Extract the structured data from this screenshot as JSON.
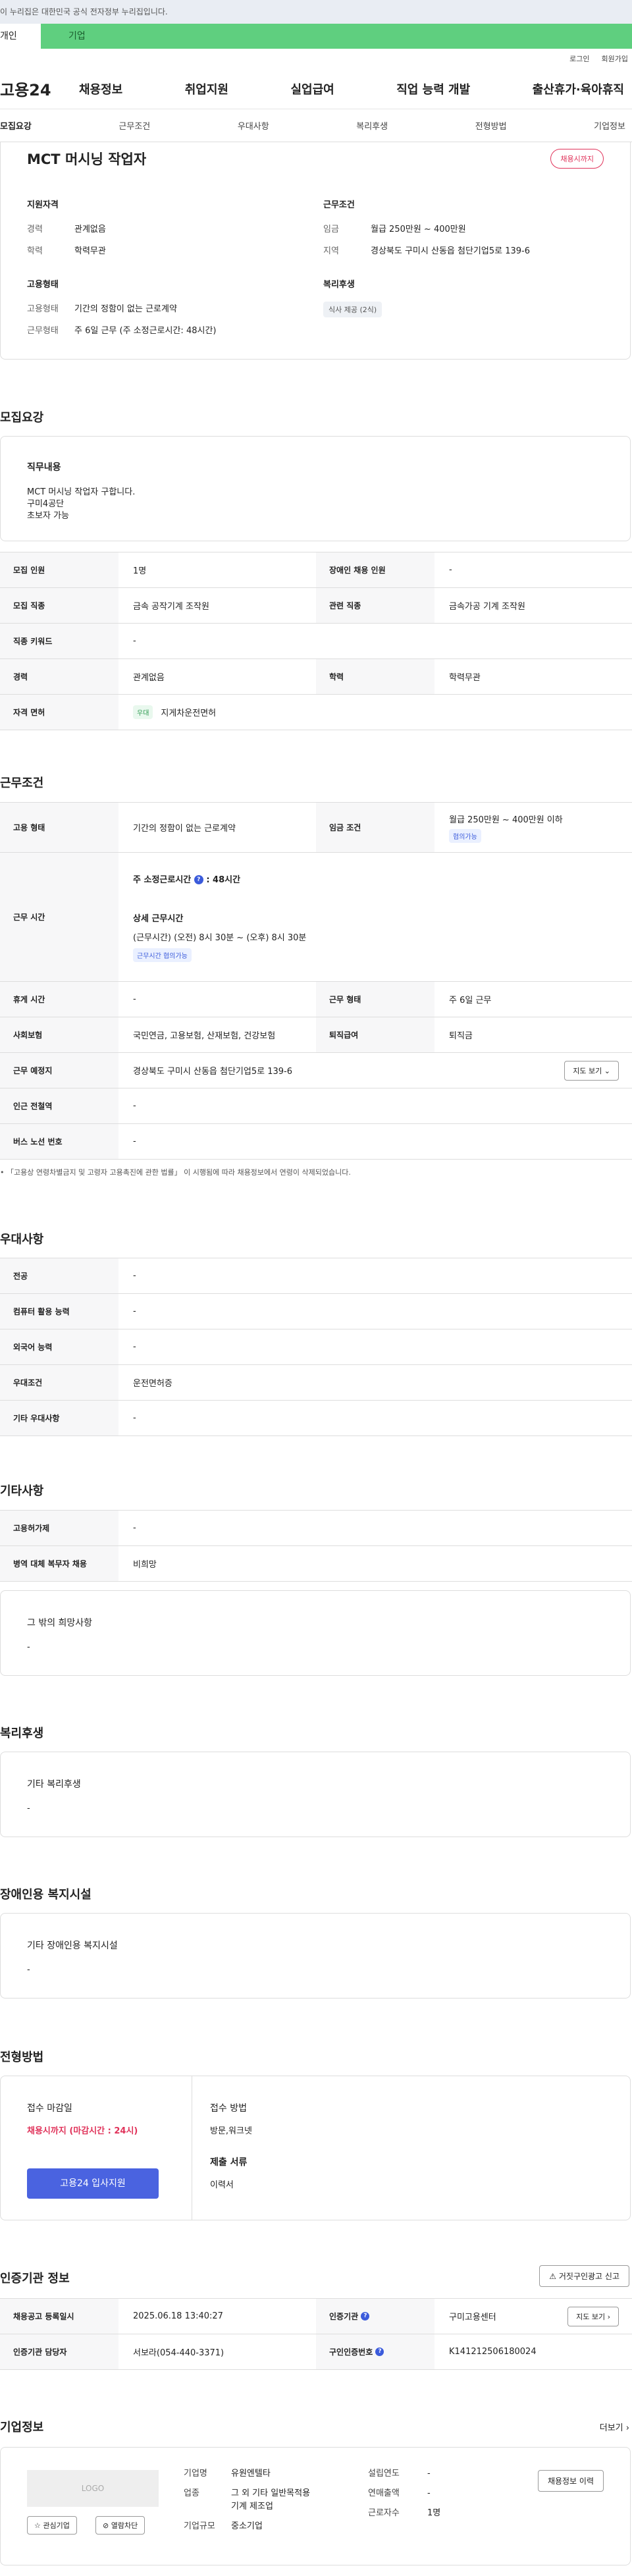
{
  "gov_banner": "이 누리집은 대한민국 공식 전자정부 누리집입니다.",
  "user_tabs": {
    "individual": "개인",
    "business": "기업"
  },
  "top_links": {
    "login": "로그인",
    "join": "회원가입"
  },
  "gnb": {
    "logo": "고용24",
    "menu": [
      "채용정보",
      "취업지원",
      "실업급여",
      "직업 능력 개발",
      "출산휴가·육아휴직"
    ]
  },
  "subtabs": [
    "모집요강",
    "근무조건",
    "우대사항",
    "복리후생",
    "전형방법",
    "기업정보"
  ],
  "job": {
    "title": "MCT 머시닝 작업자",
    "status_badge": "채용시까지",
    "qualification": {
      "heading": "지원자격",
      "career_label": "경력",
      "career": "관계없음",
      "edu_label": "학력",
      "edu": "학력무관"
    },
    "condition": {
      "heading": "근무조건",
      "wage_label": "임금",
      "wage": "월급 250만원 ~ 400만원",
      "region_label": "지역",
      "region": "경상북도 구미시 산동읍 첨단기업5로 139-6"
    },
    "employment": {
      "heading": "고용형태",
      "type_label": "고용형태",
      "type": "기간의 정함이 없는 근로계약",
      "hours_label": "근무형태",
      "hours": "주 6일 근무 (주 소정근로시간: 48시간)"
    },
    "welfare": {
      "heading": "복리후생",
      "chip": "식사 제공 (2식)"
    }
  },
  "recruit": {
    "section_title": "모집요강",
    "duty_heading": "직무내용",
    "duty_lines": [
      "MCT 머시닝 작업자 구합니다.",
      "구미4공단",
      "초보자 가능"
    ],
    "rows": [
      {
        "k1": "모집 인원",
        "v1": "1명",
        "k2": "장애인 채용 인원",
        "v2": "-"
      },
      {
        "k1": "모집 직종",
        "v1": "금속 공작기계 조작원",
        "k2": "관련 직종",
        "v2": "금속가공 기계 조작원"
      },
      {
        "k1": "직종 키워드",
        "v1": "-"
      },
      {
        "k1": "경력",
        "v1": "관계없음",
        "k2": "학력",
        "v2": "학력무관"
      },
      {
        "k1": "자격 면허",
        "tag": "우대",
        "v1": "지게차운전면허"
      }
    ]
  },
  "work": {
    "section_title": "근무조건",
    "emp_type_label": "고용 형태",
    "emp_type": "기간의 정함이 없는 근로계약",
    "wage_label": "임금 조건",
    "wage": "월급 250만원 ~ 400만원 이하",
    "wage_tag": "협의가능",
    "hours_label": "근무 시간",
    "weekly_hours": "주 소정근로시간",
    "weekly_value": ": 48시간",
    "detail_heading": "상세 근무시간",
    "detail_time": "(근무시간) (오전) 8시 30분 ~ (오후) 8시 30분",
    "hours_tag": "근무시간 협의가능",
    "rest_label": "휴게 시간",
    "rest": "-",
    "work_form_label": "근무 형태",
    "work_form": "주 6일 근무",
    "insurance_label": "사회보험",
    "insurance": "국민연금, 고용보험, 산재보험, 건강보험",
    "severance_label": "퇴직급여",
    "severance": "퇴직금",
    "place_label": "근무 예정지",
    "place": "경상북도 구미시 산동읍 첨단기업5로 139-6",
    "map_btn": "지도 보기",
    "station_label": "인근 전철역",
    "station": "-",
    "bus_label": "버스 노선 번호",
    "bus": "-",
    "note": "「고용상 연령차별금지 및 고령자 고용촉진에 관한 법률」 이 시행됨에 따라 채용정보에서 연령이 삭제되었습니다."
  },
  "pref": {
    "section_title": "우대사항",
    "rows": [
      {
        "k": "전공",
        "v": "-"
      },
      {
        "k": "컴퓨터 활용 능력",
        "v": "-"
      },
      {
        "k": "외국어 능력",
        "v": "-"
      },
      {
        "k": "우대조건",
        "v": "운전면허증"
      },
      {
        "k": "기타 우대사항",
        "v": "-"
      }
    ]
  },
  "etc": {
    "section_title": "기타사항",
    "rows": [
      {
        "k": "고용허가제",
        "v": "-"
      },
      {
        "k": "병역 대체 복무자 채용",
        "v": "비희망"
      }
    ],
    "box_heading": "그 밖의 희망사항",
    "box_value": "-"
  },
  "welfare": {
    "section_title": "복리후생",
    "box_heading": "기타 복리후생",
    "box_value": "-"
  },
  "disabled": {
    "section_title": "장애인용 복지시설",
    "box_heading": "기타 장애인용 복지시설",
    "box_value": "-"
  },
  "selection": {
    "section_title": "전형방법",
    "deadline_heading": "접수 마감일",
    "deadline_value": "채용시까지 (마감시간 : 24시)",
    "apply_btn": "고용24 입사지원",
    "method_heading": "접수 방법",
    "method_value": "방문,워크넷",
    "docs_heading": "제출 서류",
    "docs_value": "이력서"
  },
  "cert": {
    "section_title": "인증기관 정보",
    "report_btn": "거짓구인광고 신고",
    "reg_date_label": "채용공고 등록일시",
    "reg_date": "2025.06.18 13:40:27",
    "agency_label": "인증기관",
    "agency": "구미고용센터",
    "map_btn": "지도 보기",
    "manager_label": "인증기관 담당자",
    "manager": "서보라(054-440-3371)",
    "cert_no_label": "구인인증번호",
    "cert_no": "K141212506180024"
  },
  "company": {
    "section_title": "기업정보",
    "more": "더보기",
    "logo_text": "LOGO",
    "fav_btn": "관심기업",
    "block_btn": "열람차단",
    "name_label": "기업명",
    "name": "유원엔텔타",
    "industry_label": "업종",
    "industry": "그 외 기타 일반목적용 기계 제조업",
    "size_label": "기업규모",
    "size": "중소기업",
    "founded_label": "설립연도",
    "founded": "-",
    "sales_label": "연매출액",
    "sales": "-",
    "employees_label": "근로자수",
    "employees": "1명",
    "jobs_btn": "채용정보 이력"
  }
}
